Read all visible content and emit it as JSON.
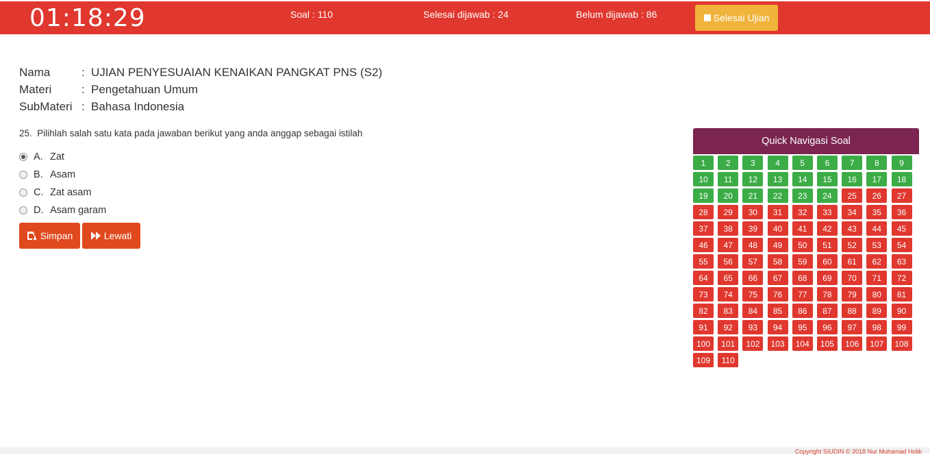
{
  "header": {
    "timer": "01:18:29",
    "soal": "Soal :  110",
    "selesai": "Selesai dijawab : 24",
    "belum": "Belum dijawab : 86",
    "finish_label": "Selesai Ujian"
  },
  "info": {
    "rows": [
      {
        "label": "Nama",
        "value": "UJIAN PENYESUAIAN KENAIKAN PANGKAT PNS (S2)"
      },
      {
        "label": "Materi",
        "value": "Pengetahuan Umum"
      },
      {
        "label": "SubMateri",
        "value": "Bahasa Indonesia"
      }
    ]
  },
  "question": {
    "number": "25.",
    "text": "Pilihlah salah satu kata pada jawaban berikut yang anda anggap sebagai istilah",
    "selected": 0,
    "options": [
      {
        "letter": "A.",
        "text": "Zat"
      },
      {
        "letter": "B.",
        "text": "Asam"
      },
      {
        "letter": "C.",
        "text": "Zat asam"
      },
      {
        "letter": "D.",
        "text": "Asam garam"
      }
    ]
  },
  "actions": {
    "save_label": "Simpan",
    "skip_label": "Lewati"
  },
  "navigation": {
    "title": "Quick Navigasi Soal",
    "total": 110,
    "answered_count": 24,
    "answered_color": "#3cac46",
    "unanswered_color": "#e0372e"
  },
  "colors": {
    "topbar": "#e0372e",
    "finish_button": "#f0b43c",
    "action_button": "#e0491e",
    "nav_header": "#7b2550"
  },
  "footer": {
    "text": "Copyright SIUDIN © 2018 Nur Muhamad Holik"
  }
}
